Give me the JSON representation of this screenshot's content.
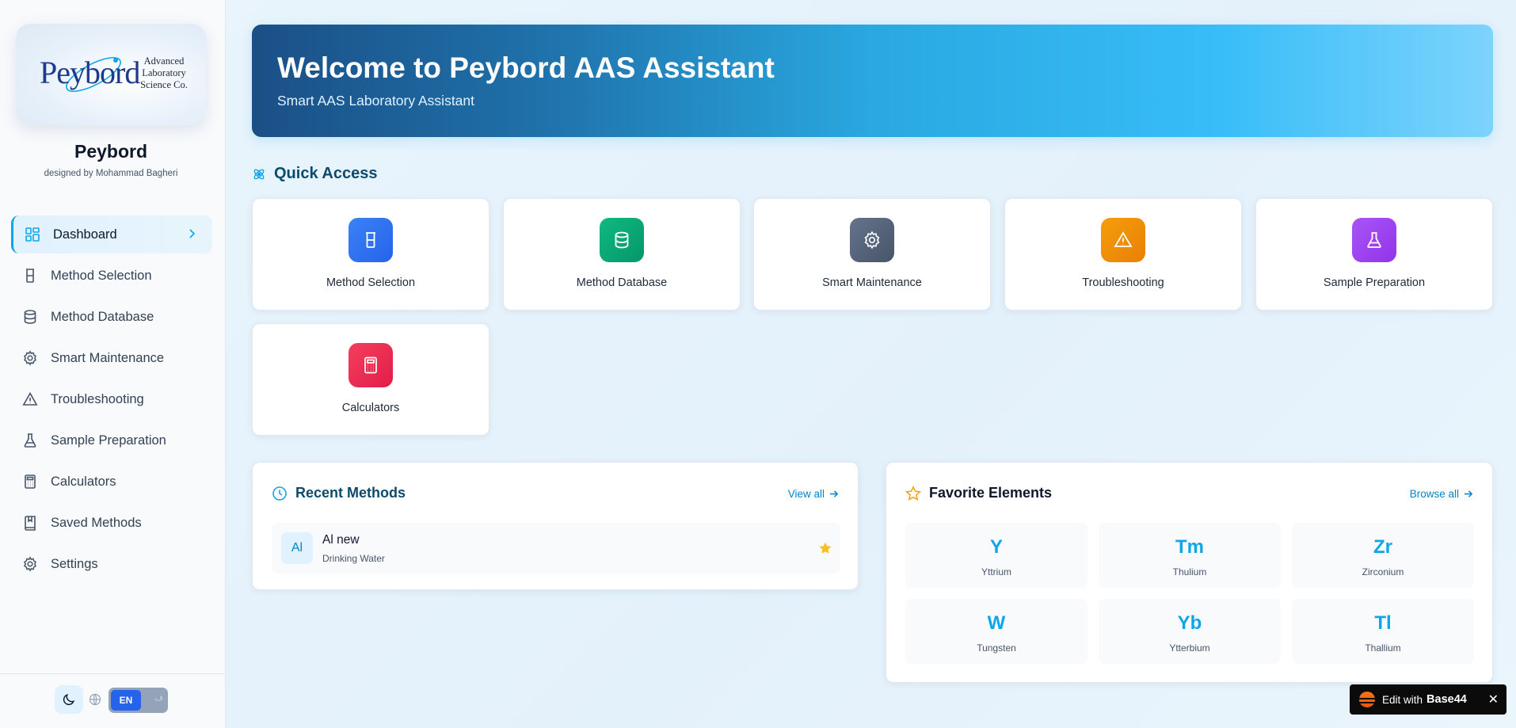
{
  "brand": {
    "logo_word": "Peybord",
    "logo_tagline": [
      "Advanced",
      "Laboratory",
      "Science Co."
    ],
    "name": "Peybord",
    "designed_by": "designed by Mohammad Bagheri"
  },
  "sidebar": {
    "items": [
      {
        "label": "Dashboard",
        "icon": "dashboard-grid-icon",
        "active": true
      },
      {
        "label": "Method Selection",
        "icon": "beaker-icon"
      },
      {
        "label": "Method Database",
        "icon": "database-icon"
      },
      {
        "label": "Smart Maintenance",
        "icon": "gear-icon"
      },
      {
        "label": "Troubleshooting",
        "icon": "warning-triangle-icon"
      },
      {
        "label": "Sample Preparation",
        "icon": "flask-icon"
      },
      {
        "label": "Calculators",
        "icon": "calculator-icon"
      },
      {
        "label": "Saved Methods",
        "icon": "bookmark-book-icon"
      },
      {
        "label": "Settings",
        "icon": "gear-icon"
      }
    ],
    "footer": {
      "theme_icon": "moon-icon",
      "language_icon": "globe-icon",
      "language_active": "EN",
      "language_other": "ف"
    }
  },
  "hero": {
    "title": "Welcome to Peybord AAS Assistant",
    "subtitle": "Smart AAS Laboratory Assistant"
  },
  "quick_access": {
    "title": "Quick Access",
    "items": [
      {
        "label": "Method Selection",
        "icon": "beaker-icon",
        "color": "#3b82f6"
      },
      {
        "label": "Method Database",
        "icon": "database-icon",
        "color": "#10b981"
      },
      {
        "label": "Smart Maintenance",
        "icon": "gear-icon",
        "color": "#64748b"
      },
      {
        "label": "Troubleshooting",
        "icon": "warning-triangle-icon",
        "color": "#f59e0b"
      },
      {
        "label": "Sample Preparation",
        "icon": "flask-icon",
        "color": "#a855f7"
      },
      {
        "label": "Calculators",
        "icon": "calculator-icon",
        "color": "#f43f5e"
      }
    ]
  },
  "recent_methods": {
    "title": "Recent Methods",
    "view_all": "View all",
    "items": [
      {
        "badge": "Al",
        "name": "Al new",
        "matrix": "Drinking Water",
        "favorite": true
      }
    ]
  },
  "favorite_elements": {
    "title": "Favorite Elements",
    "browse_all": "Browse all",
    "items": [
      {
        "symbol": "Y",
        "name": "Yttrium"
      },
      {
        "symbol": "Tm",
        "name": "Thulium"
      },
      {
        "symbol": "Zr",
        "name": "Zirconium"
      },
      {
        "symbol": "W",
        "name": "Tungsten"
      },
      {
        "symbol": "Yb",
        "name": "Ytterbium"
      },
      {
        "symbol": "Tl",
        "name": "Thallium"
      }
    ]
  },
  "edit_badge": {
    "text": "Edit with",
    "brand": "Base44",
    "close": "✕"
  },
  "colors": {
    "accent": "#0ea5e9",
    "primary": "#2563eb",
    "star": "#fbbf24"
  }
}
